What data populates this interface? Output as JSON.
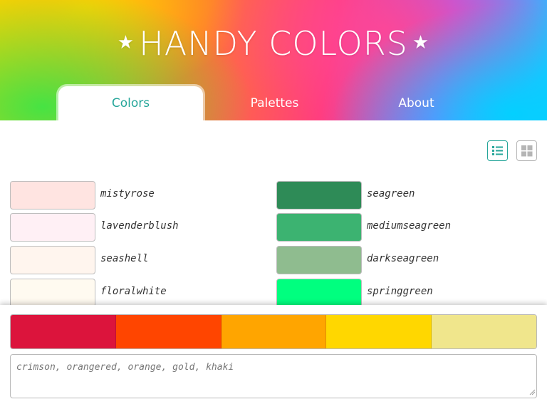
{
  "app": {
    "title": "HANDY COLORS",
    "star_left": "★",
    "star_right": "★"
  },
  "tabs": [
    {
      "label": "Colors",
      "active": true
    },
    {
      "label": "Palettes",
      "active": false
    },
    {
      "label": "About",
      "active": false
    }
  ],
  "view_toggle": {
    "list_icon": "list-view-icon",
    "grid_icon": "grid-view-icon",
    "active": "list"
  },
  "colors_left": [
    {
      "name": "mistyrose",
      "hex": "#ffe4e1"
    },
    {
      "name": "lavenderblush",
      "hex": "#fff0f5"
    },
    {
      "name": "seashell",
      "hex": "#fff5ee"
    },
    {
      "name": "floralwhite",
      "hex": "#fffaf0"
    }
  ],
  "colors_right": [
    {
      "name": "seagreen",
      "hex": "#2e8b57"
    },
    {
      "name": "mediumseagreen",
      "hex": "#3cb371"
    },
    {
      "name": "darkseagreen",
      "hex": "#8fbc8f"
    },
    {
      "name": "springgreen",
      "hex": "#00ff7f"
    }
  ],
  "palette": {
    "colors": [
      {
        "name": "crimson",
        "hex": "#dc143c"
      },
      {
        "name": "orangered",
        "hex": "#ff4500"
      },
      {
        "name": "orange",
        "hex": "#ffa500"
      },
      {
        "name": "gold",
        "hex": "#ffd700"
      },
      {
        "name": "khaki",
        "hex": "#f0e68c"
      }
    ],
    "text": "crimson, orangered, orange, gold, khaki"
  },
  "accent": "#26a69a"
}
